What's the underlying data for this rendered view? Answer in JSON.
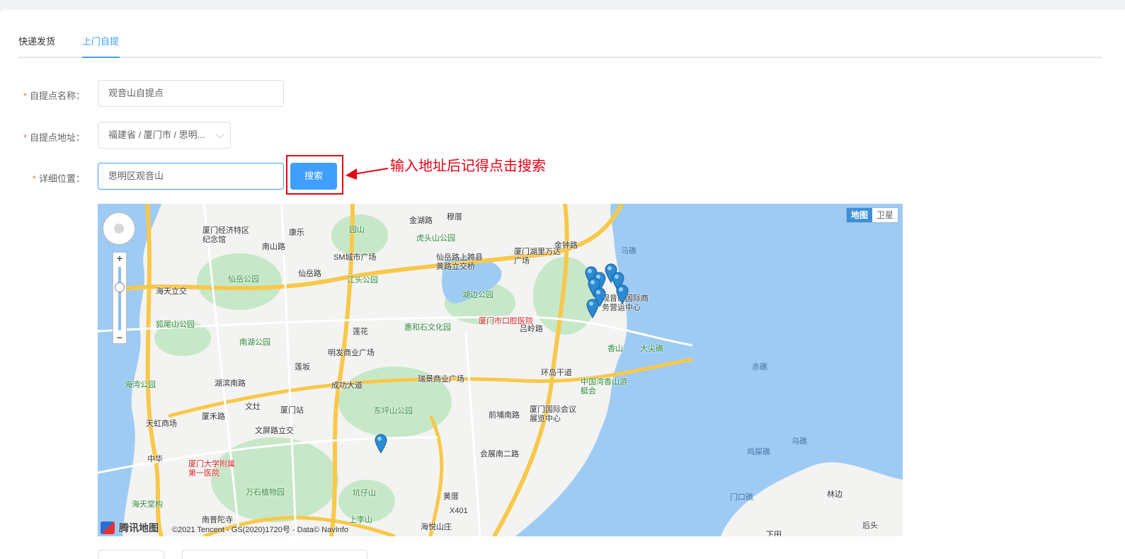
{
  "tabs": [
    {
      "label": "快递发货",
      "active": false
    },
    {
      "label": "上门自提",
      "active": true
    }
  ],
  "form": {
    "name_label": "自提点名称：",
    "name_value": "观音山自提点",
    "address_label": "自提点地址：",
    "address_value": "福建省 / 厦门市 / 思明...",
    "detail_label": "详细位置：",
    "detail_value": "思明区观音山",
    "required_mark": "*",
    "search_button": "搜索"
  },
  "annotation": {
    "text": "输入地址后记得点击搜索",
    "color": "#e50012"
  },
  "map": {
    "type_toggle": [
      "地图",
      "卫星"
    ],
    "active_type": "地图",
    "logo_text": "腾讯地图",
    "copyright": "©2021 Tencent - GS(2020)1720号 - Data© NavInfo",
    "labels": [
      {
        "text": "厦门经济特区纪念馆",
        "cls": ""
      },
      {
        "text": "康乐",
        "cls": ""
      },
      {
        "text": "园山",
        "cls": "green"
      },
      {
        "text": "金湖路",
        "cls": ""
      },
      {
        "text": "穆厝",
        "cls": ""
      },
      {
        "text": "虎头山公园",
        "cls": "green"
      },
      {
        "text": "SM城市广场",
        "cls": ""
      },
      {
        "text": "仙岳路上跨县黄路立交桥",
        "cls": ""
      },
      {
        "text": "厦门湖里万达广场",
        "cls": ""
      },
      {
        "text": "金钟路",
        "cls": ""
      },
      {
        "text": "马礁",
        "cls": "sea"
      },
      {
        "text": "南山路",
        "cls": ""
      },
      {
        "text": "仙岳公园",
        "cls": "green"
      },
      {
        "text": "仙岳路",
        "cls": ""
      },
      {
        "text": "江头公园",
        "cls": "green"
      },
      {
        "text": "湖边公园",
        "cls": "green"
      },
      {
        "text": "海天立交",
        "cls": ""
      },
      {
        "text": "厦门市口腔医院",
        "cls": "red"
      },
      {
        "text": "观音山国际商务营运中心",
        "cls": ""
      },
      {
        "text": "狐尾山公园",
        "cls": "green"
      },
      {
        "text": "莲花",
        "cls": ""
      },
      {
        "text": "惠和石文化园",
        "cls": "green"
      },
      {
        "text": "吕岭路",
        "cls": ""
      },
      {
        "text": "香山",
        "cls": "green"
      },
      {
        "text": "大尖礁",
        "cls": "green"
      },
      {
        "text": "南湖公园",
        "cls": "green"
      },
      {
        "text": "明发商业广场",
        "cls": ""
      },
      {
        "text": "赤礁",
        "cls": "sea"
      },
      {
        "text": "莲坂",
        "cls": ""
      },
      {
        "text": "瑞景商业广场",
        "cls": ""
      },
      {
        "text": "环岛干道",
        "cls": ""
      },
      {
        "text": "中国湾香山游艇会",
        "cls": "green"
      },
      {
        "text": "海湾公园",
        "cls": "green"
      },
      {
        "text": "湖滨南路",
        "cls": ""
      },
      {
        "text": "成功大道",
        "cls": ""
      },
      {
        "text": "文灶",
        "cls": ""
      },
      {
        "text": "厦门站",
        "cls": ""
      },
      {
        "text": "东坪山公园",
        "cls": "green"
      },
      {
        "text": "前埔南路",
        "cls": ""
      },
      {
        "text": "厦门国际会议展览中心",
        "cls": ""
      },
      {
        "text": "天虹商场",
        "cls": ""
      },
      {
        "text": "厦禾路",
        "cls": ""
      },
      {
        "text": "文屏路立交",
        "cls": ""
      },
      {
        "text": "乌礁",
        "cls": "sea"
      },
      {
        "text": "鸡屎礁",
        "cls": "sea"
      },
      {
        "text": "中华",
        "cls": ""
      },
      {
        "text": "厦门大学附属第一医院",
        "cls": "red"
      },
      {
        "text": "会展南二路",
        "cls": ""
      },
      {
        "text": "万石植物园",
        "cls": "green"
      },
      {
        "text": "坑仔山",
        "cls": "green"
      },
      {
        "text": "黄厝",
        "cls": ""
      },
      {
        "text": "门口礁",
        "cls": "sea"
      },
      {
        "text": "海天堂构",
        "cls": "green"
      },
      {
        "text": "南普陀寺",
        "cls": ""
      },
      {
        "text": "上李山",
        "cls": "green"
      },
      {
        "text": "海悦山庄",
        "cls": ""
      },
      {
        "text": "X401",
        "cls": ""
      },
      {
        "text": "林边",
        "cls": ""
      },
      {
        "text": "下田",
        "cls": ""
      },
      {
        "text": "后头",
        "cls": ""
      }
    ]
  }
}
